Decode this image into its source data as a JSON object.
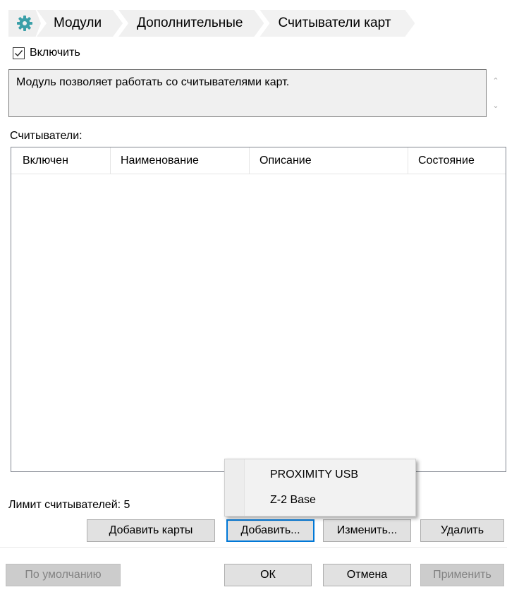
{
  "breadcrumb": {
    "icon": "gear-icon",
    "accent": "#3a9fa8",
    "items": [
      "Модули",
      "Дополнительные",
      "Считыватели карт"
    ]
  },
  "enable": {
    "label": "Включить",
    "checked": true
  },
  "description": "Модуль позволяет работать со считывателями карт.",
  "readers": {
    "label": "Считыватели:",
    "columns": [
      "Включен",
      "Наименование",
      "Описание",
      "Состояние"
    ],
    "rows": []
  },
  "add_menu": {
    "items": [
      "PROXIMITY USB",
      "Z-2 Base"
    ]
  },
  "limit": "Лимит считывателей: 5",
  "buttons": {
    "add_cards": "Добавить карты",
    "add": "Добавить...",
    "edit": "Изменить...",
    "delete": "Удалить",
    "defaults": "По умолчанию",
    "ok": "ОК",
    "cancel": "Отмена",
    "apply": "Применить"
  }
}
